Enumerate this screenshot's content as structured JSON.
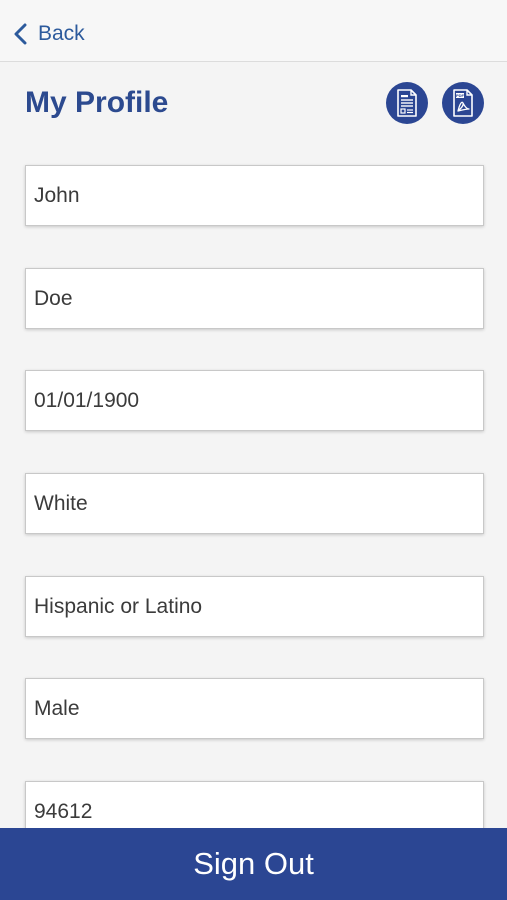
{
  "nav": {
    "back_label": "Back",
    "back_icon": "chevron-left-icon"
  },
  "header": {
    "title": "My Profile",
    "actions": [
      {
        "icon": "document-form-icon"
      },
      {
        "icon": "pdf-document-icon",
        "badge": "PDF"
      }
    ]
  },
  "profile_fields": [
    {
      "name": "first-name-field",
      "value": "John"
    },
    {
      "name": "last-name-field",
      "value": "Doe"
    },
    {
      "name": "date-of-birth-field",
      "value": "01/01/1900"
    },
    {
      "name": "race-field",
      "value": "White"
    },
    {
      "name": "ethnicity-field",
      "value": "Hispanic or Latino"
    },
    {
      "name": "sex-field",
      "value": "Male"
    },
    {
      "name": "zip-code-field",
      "value": "94612"
    }
  ],
  "footer": {
    "sign_out_label": "Sign Out"
  },
  "colors": {
    "primary": "#2b4693",
    "title": "#2c4a8f",
    "link": "#2c5a9c",
    "background": "#f4f4f4"
  }
}
